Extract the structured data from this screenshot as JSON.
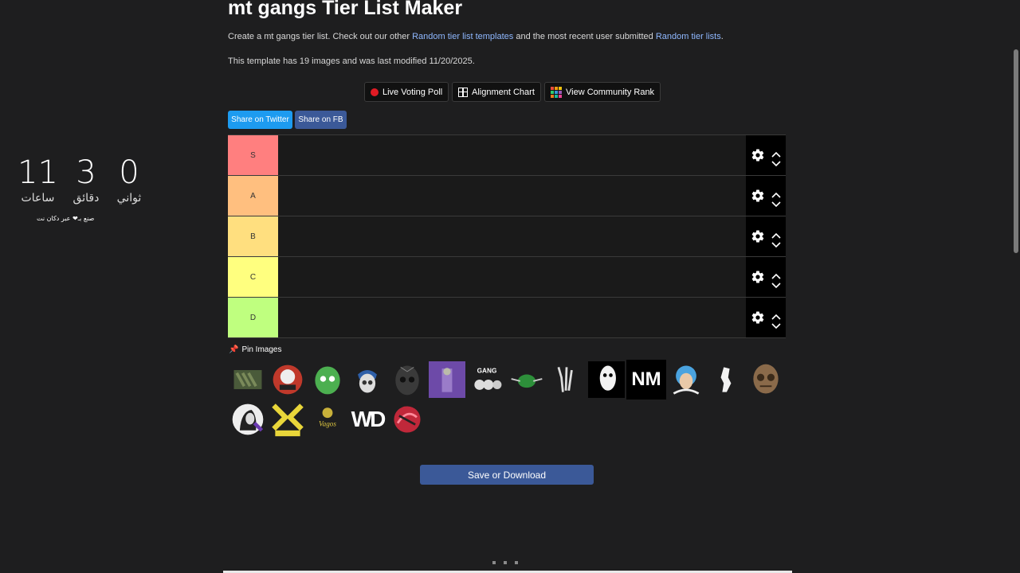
{
  "page": {
    "title": "mt gangs Tier List Maker",
    "intro_before": "Create a mt gangs tier list. Check out our other ",
    "link_templates": "Random tier list templates",
    "intro_middle": " and the most recent user submitted ",
    "link_lists": "Random tier lists",
    "intro_end": ".",
    "meta": "This template has 19 images and was last modified 11/20/2025."
  },
  "features": {
    "live_voting": "Live Voting Poll",
    "alignment": "Alignment Chart",
    "community": "View Community Rank"
  },
  "share": {
    "twitter": "Share on Twitter",
    "facebook": "Share on FB"
  },
  "tiers": [
    {
      "label": "S",
      "color": "#ff7f7f"
    },
    {
      "label": "A",
      "color": "#ffbf7f"
    },
    {
      "label": "B",
      "color": "#ffdf7f"
    },
    {
      "label": "C",
      "color": "#ffff7f"
    },
    {
      "label": "D",
      "color": "#bfff7f"
    }
  ],
  "pin_label": "Pin Images",
  "pool_images": [
    {
      "name": "gang-logo-camo"
    },
    {
      "name": "gang-logo-26-yard"
    },
    {
      "name": "gang-logo-green-skull"
    },
    {
      "name": "gang-logo-blue-skull"
    },
    {
      "name": "gang-logo-dark-skull"
    },
    {
      "name": "gang-logo-purple-photo"
    },
    {
      "name": "gang-logo-mundo-gang"
    },
    {
      "name": "gang-logo-green-bandana"
    },
    {
      "name": "gang-logo-peace-hand"
    },
    {
      "name": "gang-logo-mask-face"
    },
    {
      "name": "gang-logo-nm",
      "text": "NM"
    },
    {
      "name": "gang-logo-blue-portrait"
    },
    {
      "name": "gang-logo-white-figure"
    },
    {
      "name": "gang-logo-ornate-skull"
    },
    {
      "name": "gang-logo-sons-of-anarchy"
    },
    {
      "name": "gang-logo-trickster"
    },
    {
      "name": "gang-logo-vagos"
    },
    {
      "name": "gang-logo-wd",
      "text": "WD"
    },
    {
      "name": "gang-logo-red-emblem"
    }
  ],
  "save_label": "Save or Download",
  "countdown": {
    "hours": "11",
    "hours_label": "ساعات",
    "minutes": "3",
    "minutes_label": "دقائق",
    "seconds": "0",
    "seconds_label": "ثواني",
    "credit": "صنع بـ❤ عبر دكان نت"
  }
}
